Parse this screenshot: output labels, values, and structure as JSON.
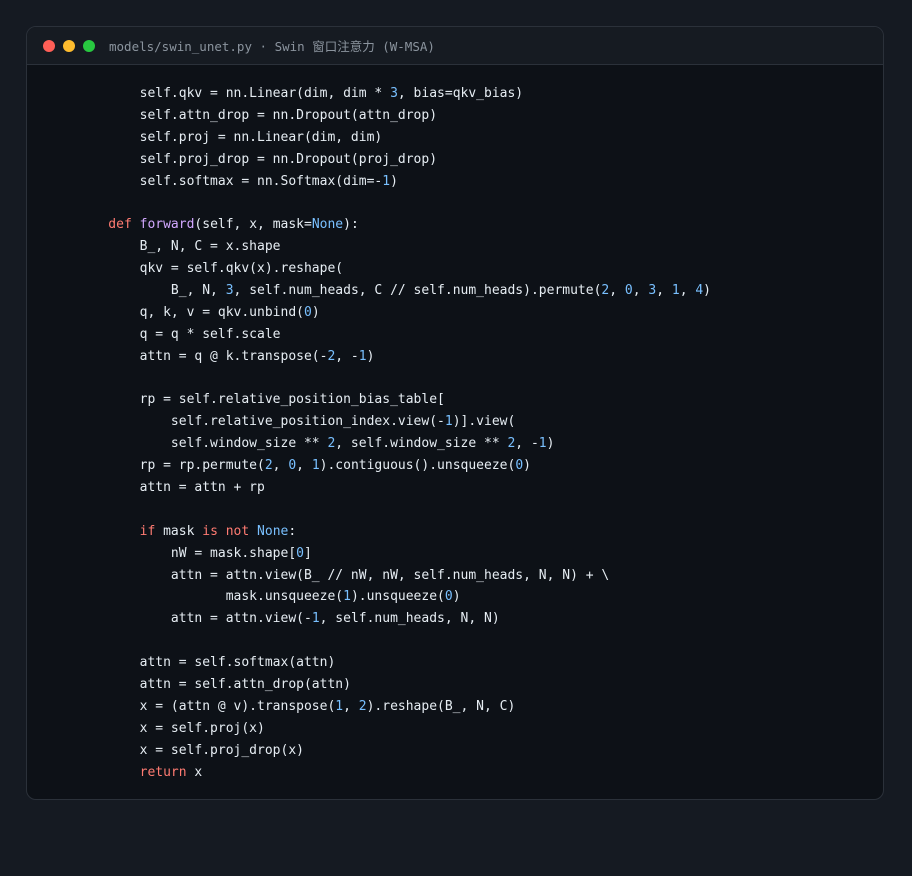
{
  "window": {
    "title": "models/swin_unet.py · Swin 窗口注意力 (W-MSA)",
    "controls": {
      "close_color": "#ff5f57",
      "minimize_color": "#febc2e",
      "maximize_color": "#28c840"
    }
  },
  "colors": {
    "background": "#0d1117",
    "keyword": "#ff7b72",
    "function": "#d2a8ff",
    "number": "#79c0ff",
    "text": "#e6edf3"
  },
  "code": {
    "lines": [
      [
        {
          "i": 8,
          "t": "self.qkv = nn.Linear(dim, dim * "
        },
        {
          "t": "3",
          "c": "num"
        },
        {
          "t": ", bias=qkv_bias)"
        }
      ],
      [
        {
          "i": 8,
          "t": "self.attn_drop = nn.Dropout(attn_drop)"
        }
      ],
      [
        {
          "i": 8,
          "t": "self.proj = nn.Linear(dim, dim)"
        }
      ],
      [
        {
          "i": 8,
          "t": "self.proj_drop = nn.Dropout(proj_drop)"
        }
      ],
      [
        {
          "i": 8,
          "t": "self.softmax = nn.Softmax(dim=-"
        },
        {
          "t": "1",
          "c": "num"
        },
        {
          "t": ")"
        }
      ],
      [],
      [
        {
          "i": 4,
          "t": "def",
          "c": "kw"
        },
        {
          "t": " "
        },
        {
          "t": "forward",
          "c": "fn"
        },
        {
          "t": "(self, x, mask="
        },
        {
          "t": "None",
          "c": "cst"
        },
        {
          "t": "):"
        }
      ],
      [
        {
          "i": 8,
          "t": "B_, N, C = x.shape"
        }
      ],
      [
        {
          "i": 8,
          "t": "qkv = self.qkv(x).reshape("
        }
      ],
      [
        {
          "i": 12,
          "t": "B_, N, "
        },
        {
          "t": "3",
          "c": "num"
        },
        {
          "t": ", self.num_heads, C // self.num_heads).permute("
        },
        {
          "t": "2",
          "c": "num"
        },
        {
          "t": ", "
        },
        {
          "t": "0",
          "c": "num"
        },
        {
          "t": ", "
        },
        {
          "t": "3",
          "c": "num"
        },
        {
          "t": ", "
        },
        {
          "t": "1",
          "c": "num"
        },
        {
          "t": ", "
        },
        {
          "t": "4",
          "c": "num"
        },
        {
          "t": ")"
        }
      ],
      [
        {
          "i": 8,
          "t": "q, k, v = qkv.unbind("
        },
        {
          "t": "0",
          "c": "num"
        },
        {
          "t": ")"
        }
      ],
      [
        {
          "i": 8,
          "t": "q = q * self.scale"
        }
      ],
      [
        {
          "i": 8,
          "t": "attn = q @ k.transpose(-"
        },
        {
          "t": "2",
          "c": "num"
        },
        {
          "t": ", -"
        },
        {
          "t": "1",
          "c": "num"
        },
        {
          "t": ")"
        }
      ],
      [],
      [
        {
          "i": 8,
          "t": "rp = self.relative_position_bias_table["
        }
      ],
      [
        {
          "i": 12,
          "t": "self.relative_position_index.view(-"
        },
        {
          "t": "1",
          "c": "num"
        },
        {
          "t": ")].view("
        }
      ],
      [
        {
          "i": 12,
          "t": "self.window_size ** "
        },
        {
          "t": "2",
          "c": "num"
        },
        {
          "t": ", self.window_size ** "
        },
        {
          "t": "2",
          "c": "num"
        },
        {
          "t": ", -"
        },
        {
          "t": "1",
          "c": "num"
        },
        {
          "t": ")"
        }
      ],
      [
        {
          "i": 8,
          "t": "rp = rp.permute("
        },
        {
          "t": "2",
          "c": "num"
        },
        {
          "t": ", "
        },
        {
          "t": "0",
          "c": "num"
        },
        {
          "t": ", "
        },
        {
          "t": "1",
          "c": "num"
        },
        {
          "t": ").contiguous().unsqueeze("
        },
        {
          "t": "0",
          "c": "num"
        },
        {
          "t": ")"
        }
      ],
      [
        {
          "i": 8,
          "t": "attn = attn + rp"
        }
      ],
      [],
      [
        {
          "i": 8,
          "t": "if",
          "c": "kw"
        },
        {
          "t": " mask "
        },
        {
          "t": "is not",
          "c": "kw"
        },
        {
          "t": " "
        },
        {
          "t": "None",
          "c": "cst"
        },
        {
          "t": ":"
        }
      ],
      [
        {
          "i": 12,
          "t": "nW = mask.shape["
        },
        {
          "t": "0",
          "c": "num"
        },
        {
          "t": "]"
        }
      ],
      [
        {
          "i": 12,
          "t": "attn = attn.view(B_ // nW, nW, self.num_heads, N, N) + \\"
        }
      ],
      [
        {
          "i": 19,
          "t": "mask.unsqueeze("
        },
        {
          "t": "1",
          "c": "num"
        },
        {
          "t": ").unsqueeze("
        },
        {
          "t": "0",
          "c": "num"
        },
        {
          "t": ")"
        }
      ],
      [
        {
          "i": 12,
          "t": "attn = attn.view(-"
        },
        {
          "t": "1",
          "c": "num"
        },
        {
          "t": ", self.num_heads, N, N)"
        }
      ],
      [],
      [
        {
          "i": 8,
          "t": "attn = self.softmax(attn)"
        }
      ],
      [
        {
          "i": 8,
          "t": "attn = self.attn_drop(attn)"
        }
      ],
      [
        {
          "i": 8,
          "t": "x = (attn @ v).transpose("
        },
        {
          "t": "1",
          "c": "num"
        },
        {
          "t": ", "
        },
        {
          "t": "2",
          "c": "num"
        },
        {
          "t": ").reshape(B_, N, C)"
        }
      ],
      [
        {
          "i": 8,
          "t": "x = self.proj(x)"
        }
      ],
      [
        {
          "i": 8,
          "t": "x = self.proj_drop(x)"
        }
      ],
      [
        {
          "i": 8,
          "t": "return",
          "c": "kw"
        },
        {
          "t": " x"
        }
      ]
    ]
  }
}
